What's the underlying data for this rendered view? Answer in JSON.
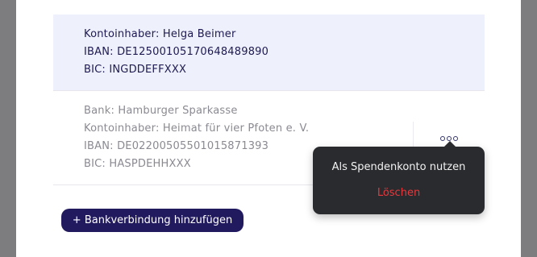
{
  "accounts": [
    {
      "lines": [
        "Kontoinhaber: Helga Beimer",
        "IBAN: DE12500105170648489890",
        "BIC: INGDDEFFXXX"
      ]
    },
    {
      "lines": [
        "Bank: Hamburger Sparkasse",
        "Kontoinhaber: Heimat für vier Pfoten e. V.",
        "IBAN: DE02200505501015871393",
        "BIC: HASPDEHHXXX"
      ]
    }
  ],
  "add_button_label": "+ Bankverbindung hinzufügen",
  "context_menu": {
    "items": [
      "Als Spendenkonto nutzen",
      "Löschen"
    ]
  },
  "colors": {
    "primary": "#211a5e",
    "selected_background": "#eef0fb",
    "danger": "#e5393e",
    "popup_background": "#2a2b2e"
  },
  "icons": {
    "more_options": "more-options-icon"
  }
}
